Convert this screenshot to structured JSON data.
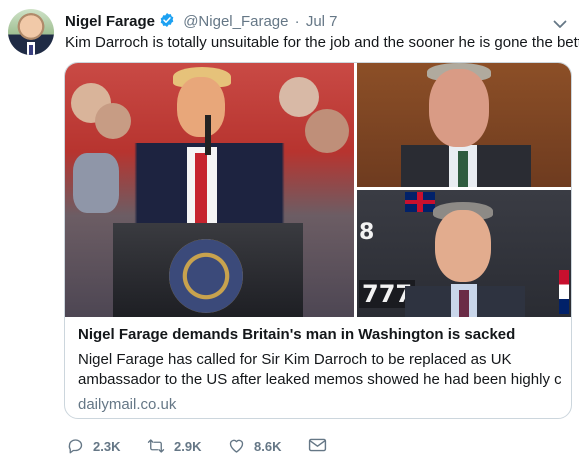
{
  "tweet": {
    "author_name": "Nigel Farage",
    "handle": "@Nigel_Farage",
    "separator": "·",
    "date": "Jul 7",
    "text": "Kim Darroch is totally unsuitable for the job and the sooner he is gone the better.",
    "verified": true
  },
  "card": {
    "title": "Nigel Farage demands Britain's man in Washington is sacked",
    "description_line1": "Nigel Farage has called for Sir Kim Darroch to be replaced as UK",
    "description_line2": "ambassador to the US after leaked memos showed he had been highly c...",
    "domain": "dailymail.co.uk",
    "photo_labels": {
      "number_top": "8",
      "number_bottom": "777"
    }
  },
  "actions": {
    "replies": "2.3K",
    "retweets": "2.9K",
    "likes": "8.6K"
  },
  "icons": {
    "verified": "verified-badge-icon",
    "caret": "chevron-down-icon",
    "reply": "reply-icon",
    "retweet": "retweet-icon",
    "like": "heart-icon",
    "dm": "envelope-icon"
  },
  "colors": {
    "text": "#14171a",
    "secondary": "#657786",
    "verified": "#1da1f2",
    "border": "#ccd6dd"
  }
}
